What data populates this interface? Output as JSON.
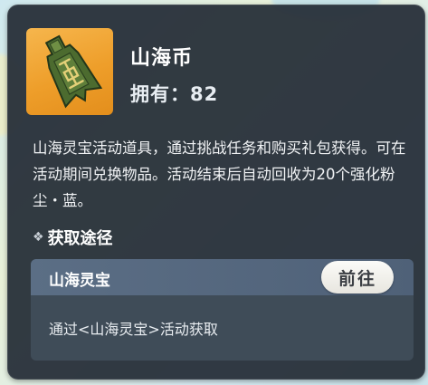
{
  "item": {
    "name": "山海币",
    "owned_label": "拥有：",
    "owned_count": "82",
    "icon": "ancient-coin-icon",
    "description": "山海灵宝活动道具，通过挑战任务和购买礼包获得。可在活动期间兑换物品。活动结束后自动回收为20个强化粉尘・蓝。"
  },
  "acquisition": {
    "section_title": "获取途径",
    "section_icon": "diamond-bullet-icon",
    "sources": [
      {
        "name": "山海灵宝",
        "button_label": "前往",
        "detail": "通过<山海灵宝>活动获取"
      }
    ]
  },
  "colors": {
    "panel_bg": "#252e37",
    "icon_bg": "#ee9e2a",
    "source_header": "#5b6e85",
    "button_bg": "#f4f3ee"
  }
}
